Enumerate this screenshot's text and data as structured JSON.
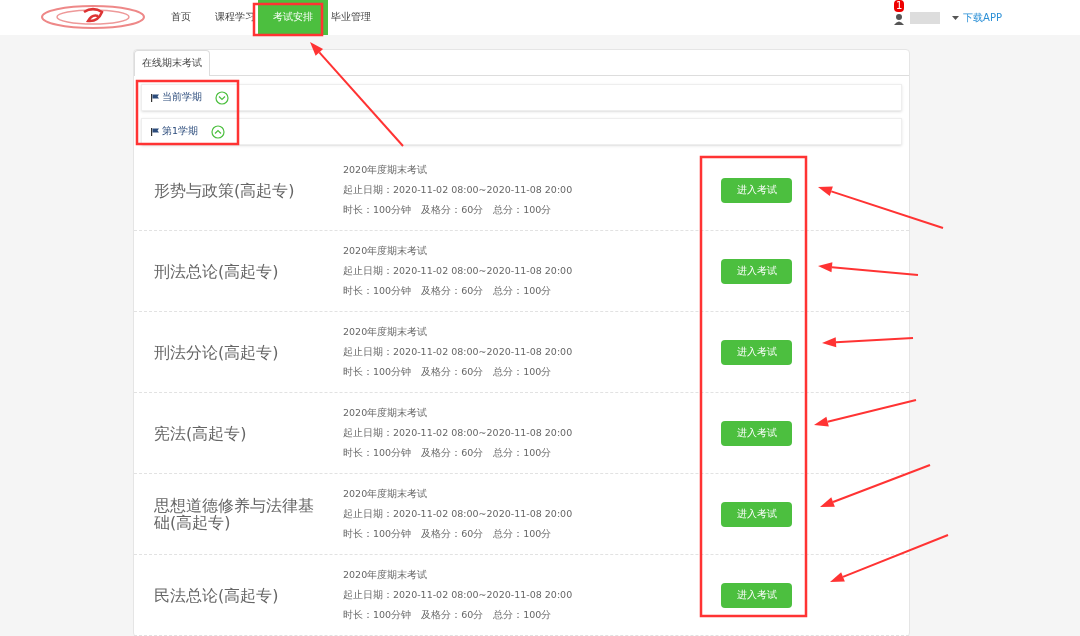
{
  "nav": {
    "items": [
      {
        "label": "首页",
        "selected": false
      },
      {
        "label": "课程学习",
        "selected": false
      },
      {
        "label": "考试安排",
        "selected": true
      },
      {
        "label": "毕业管理",
        "selected": false
      }
    ],
    "badge": "1",
    "download": "下载APP"
  },
  "tabs": [
    {
      "label": "在线期末考试",
      "selected": true
    }
  ],
  "semesters": [
    {
      "label": "当前学期",
      "expanded": false
    },
    {
      "label": "第1学期",
      "expanded": true
    }
  ],
  "exams": [
    {
      "course": "形势与政策(高起专)",
      "exam": "2020年度期末考试",
      "dates": "起止日期：2020-11-02 08:00~2020-11-08 20:00",
      "duration": "时长：100分钟",
      "pass": "及格分：60分",
      "total": "总分：100分",
      "button": "进入考试"
    },
    {
      "course": "刑法总论(高起专)",
      "exam": "2020年度期末考试",
      "dates": "起止日期：2020-11-02 08:00~2020-11-08 20:00",
      "duration": "时长：100分钟",
      "pass": "及格分：60分",
      "total": "总分：100分",
      "button": "进入考试"
    },
    {
      "course": "刑法分论(高起专)",
      "exam": "2020年度期末考试",
      "dates": "起止日期：2020-11-02 08:00~2020-11-08 20:00",
      "duration": "时长：100分钟",
      "pass": "及格分：60分",
      "total": "总分：100分",
      "button": "进入考试"
    },
    {
      "course": "宪法(高起专)",
      "exam": "2020年度期末考试",
      "dates": "起止日期：2020-11-02 08:00~2020-11-08 20:00",
      "duration": "时长：100分钟",
      "pass": "及格分：60分",
      "total": "总分：100分",
      "button": "进入考试"
    },
    {
      "course": "思想道德修养与法律基础(高起专)",
      "exam": "2020年度期末考试",
      "dates": "起止日期：2020-11-02 08:00~2020-11-08 20:00",
      "duration": "时长：100分钟",
      "pass": "及格分：60分",
      "total": "总分：100分",
      "button": "进入考试"
    },
    {
      "course": "民法总论(高起专)",
      "exam": "2020年度期末考试",
      "dates": "起止日期：2020-11-02 08:00~2020-11-08 20:00",
      "duration": "时长：100分钟",
      "pass": "及格分：60分",
      "total": "总分：100分",
      "button": "进入考试"
    }
  ]
}
